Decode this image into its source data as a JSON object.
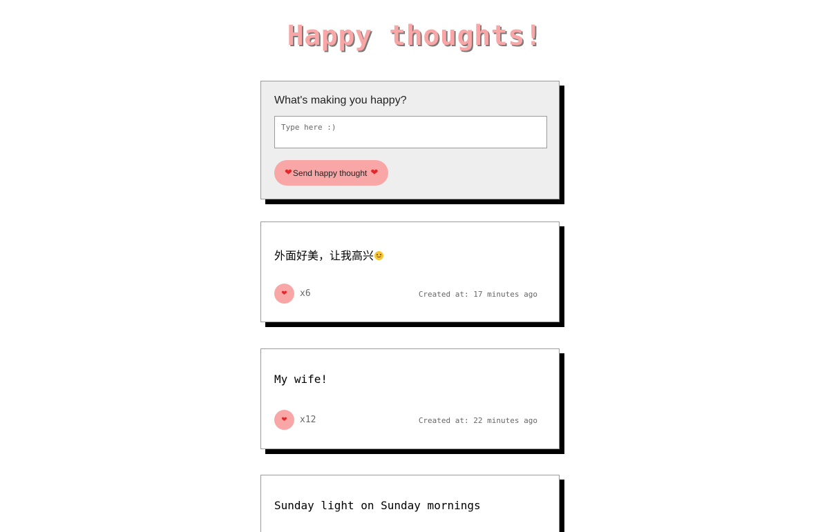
{
  "page": {
    "title": "Happy thoughts!"
  },
  "form": {
    "prompt": "What's making you happy?",
    "input_placeholder": "Type here :)",
    "input_value": "",
    "send_label": "Send happy thought",
    "send_icon": "heart-icon"
  },
  "thoughts": [
    {
      "text": "外面好美，让我高兴",
      "trailing_icon": "smiling-face-icon",
      "likes": "x6",
      "created": "Created at: 17 minutes ago"
    },
    {
      "text": "My wife!",
      "likes": "x12",
      "created": "Created at: 22 minutes ago"
    },
    {
      "text": "Sunday light on Sunday mornings"
    }
  ],
  "colors": {
    "accent_pink": "#f8a6a6",
    "heart_red": "#e5262b",
    "form_background": "#eeeeee",
    "shadow": "#000000"
  }
}
